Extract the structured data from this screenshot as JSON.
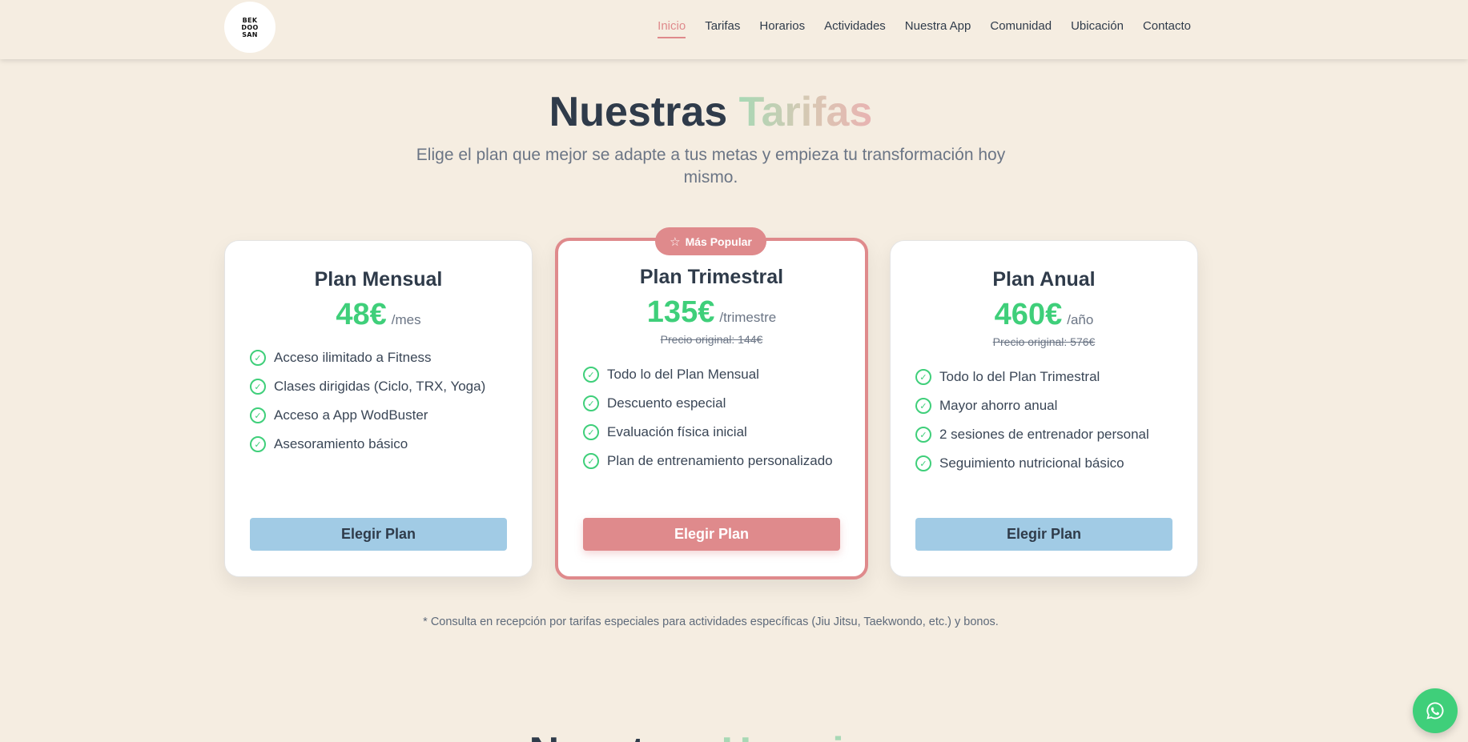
{
  "header": {
    "logo_lines": [
      "BEK",
      "DOO",
      "SAN"
    ],
    "nav": [
      "Inicio",
      "Tarifas",
      "Horarios",
      "Actividades",
      "Nuestra App",
      "Comunidad",
      "Ubicación",
      "Contacto"
    ],
    "active_nav": "Inicio"
  },
  "hero": {
    "title_main": "Nuestras",
    "title_accent": "Tarifas",
    "subtitle": "Elige el plan que mejor se adapte a tus metas y empieza tu transformación hoy mismo."
  },
  "badge_label": "Más Popular",
  "plans": [
    {
      "name": "Plan Mensual",
      "price": "48€",
      "period": "/mes",
      "original": "",
      "features": [
        "Acceso ilimitado a Fitness",
        "Clases dirigidas (Ciclo, TRX, Yoga)",
        "Acceso a App WodBuster",
        "Asesoramiento básico"
      ],
      "button": "Elegir Plan"
    },
    {
      "name": "Plan Trimestral",
      "price": "135€",
      "period": "/trimestre",
      "original": "Precio original: 144€",
      "features": [
        "Todo lo del Plan Mensual",
        "Descuento especial",
        "Evaluación física inicial",
        "Plan de entrenamiento personalizado"
      ],
      "button": "Elegir Plan"
    },
    {
      "name": "Plan Anual",
      "price": "460€",
      "period": "/año",
      "original": "Precio original: 576€",
      "features": [
        "Todo lo del Plan Trimestral",
        "Mayor ahorro anual",
        "2 sesiones de entrenador personal",
        "Seguimiento nutricional básico"
      ],
      "button": "Elegir Plan"
    }
  ],
  "footnote": "* Consulta en recepción por tarifas especiales para actividades específicas (Jiu Jitsu, Taekwondo, etc.) y bonos.",
  "next_section": {
    "title_main": "Nuestros",
    "title_accent": "Horarios"
  },
  "colors": {
    "background": "#f5ede1",
    "accent_red": "#df8a8c",
    "accent_green": "#3fcf7a",
    "button_blue": "#a1cbe5"
  }
}
